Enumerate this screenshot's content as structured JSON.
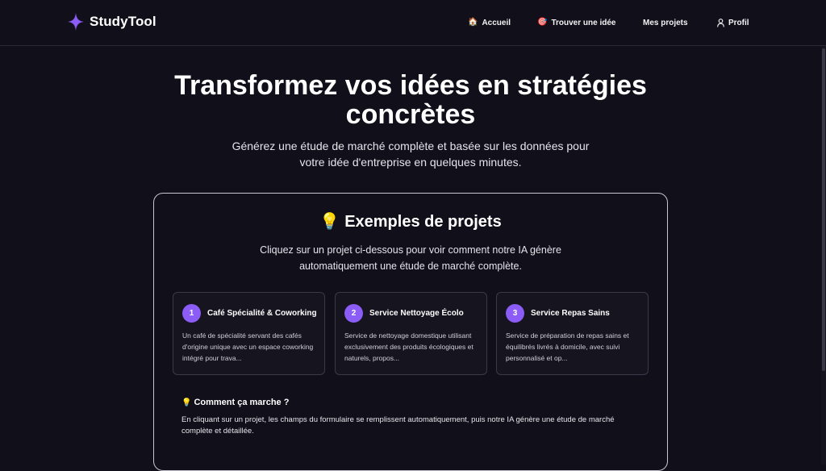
{
  "brand": {
    "name": "StudyTool",
    "logo_icon": "sparkle-icon",
    "accent": "#8b5cf6"
  },
  "nav": {
    "home": {
      "label": "Accueil",
      "icon": "house-emoji-icon"
    },
    "find_idea": {
      "label": "Trouver une idée",
      "icon": "target-emoji-icon"
    },
    "projects": {
      "label": "Mes projets"
    },
    "profile": {
      "label": "Profil",
      "icon": "user-icon"
    }
  },
  "hero": {
    "title_line1": "Transformez vos idées en stratégies",
    "title_line2": "concrètes",
    "subtitle_line1": "Générez une étude de marché complète et basée sur les données pour",
    "subtitle_line2": "votre idée d'entreprise en quelques minutes."
  },
  "examples": {
    "icon": "💡",
    "title": "Exemples de projets",
    "subtitle_line1": "Cliquez sur un projet ci-dessous pour voir comment notre IA génère",
    "subtitle_line2": "automatiquement une étude de marché complète.",
    "cards": [
      {
        "number": "1",
        "title": "Café Spécialité & Coworking",
        "description": "Un café de spécialité servant des cafés d'origine unique avec un espace coworking intégré pour trava..."
      },
      {
        "number": "2",
        "title": "Service Nettoyage Écolo",
        "description": "Service de nettoyage domestique utilisant exclusivement des produits écologiques et naturels, propos..."
      },
      {
        "number": "3",
        "title": "Service Repas Sains",
        "description": "Service de préparation de repas sains et équilibrés livrés à domicile, avec suivi personnalisé et op..."
      }
    ],
    "how": {
      "icon": "💡",
      "title": "Comment ça marche ?",
      "text": "En cliquant sur un projet, les champs du formulaire se remplissent automatiquement, puis notre IA génère une étude de marché complète et détaillée."
    }
  }
}
